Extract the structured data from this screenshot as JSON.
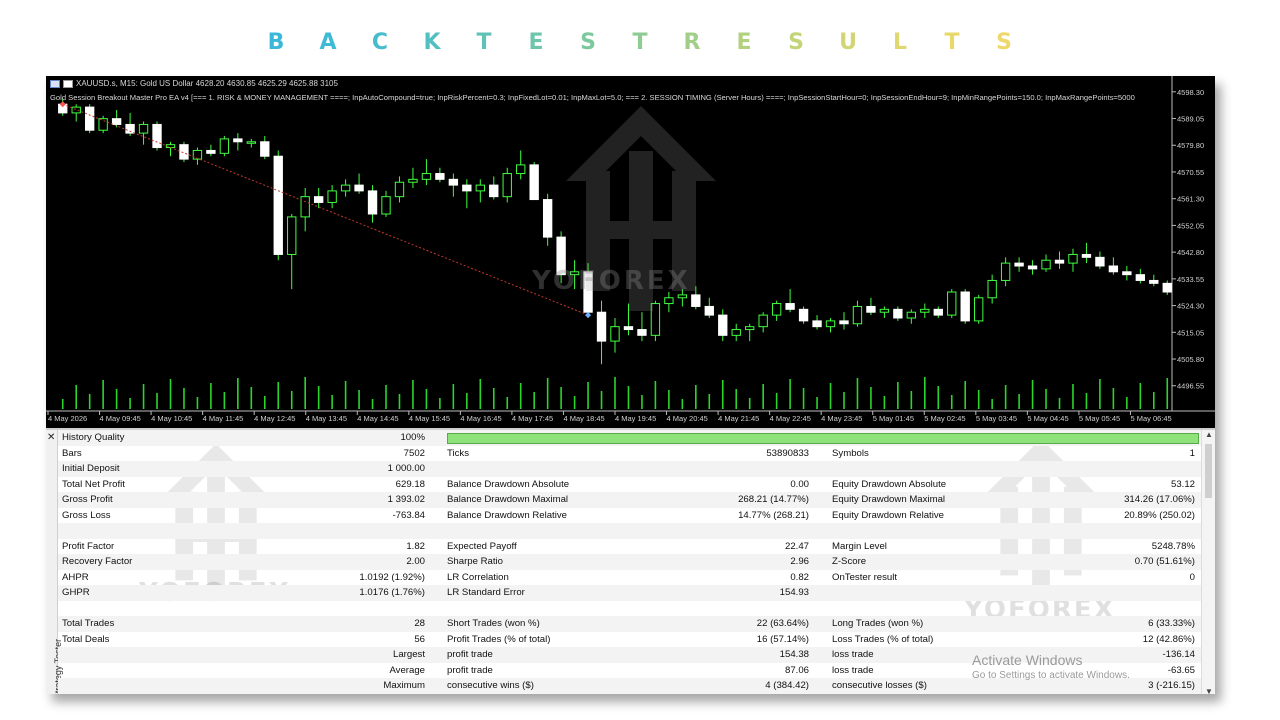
{
  "banner": {
    "letters": [
      "B",
      "A",
      "C",
      "K",
      "T",
      "E",
      "S",
      "T",
      "R",
      "E",
      "S",
      "U",
      "L",
      "T",
      "S"
    ],
    "colors": [
      "#3bb8d9",
      "#3fbad4",
      "#47bccd",
      "#52bfc3",
      "#5fc2b7",
      "#6ec5ab",
      "#7ec89e",
      "#8fcb92",
      "#a1ce88",
      "#b2d17f",
      "#c3d479",
      "#d2d574",
      "#dfd770",
      "#e9d86d",
      "#efd86b"
    ]
  },
  "chart": {
    "symbol_line": "XAUUSD.s, M15:  Gold US Dollar  4628.20 4630.85 4625.29 4625.88  3105",
    "params_line": "Gold Session Breakout Master Pro EA v4 [=== 1. RISK & MONEY MANAGEMENT ====; InpAutoCompound=true; InpRiskPercent=0.3; InpFixedLot=0.01; InpMaxLot=5.0; === 2. SESSION TIMING (Server Hours) ====; InpSessionStartHour=0; InpSessionEndHour=9; InpMinRangePoints=150.0; InpMaxRangePoints=5000",
    "price_labels": [
      "4598.30",
      "4589.05",
      "4579.80",
      "4570.55",
      "4561.30",
      "4552.05",
      "4542.80",
      "4533.55",
      "4524.30",
      "4515.05",
      "4505.80",
      "4496.55"
    ],
    "time_labels": [
      "4 May 2026",
      "4 May 09:45",
      "4 May 10:45",
      "4 May 11:45",
      "4 May 12:45",
      "4 May 13:45",
      "4 May 14:45",
      "4 May 15:45",
      "4 May 16:45",
      "4 May 17:45",
      "4 May 18:45",
      "4 May 19:45",
      "4 May 20:45",
      "4 May 21:45",
      "4 May 22:45",
      "4 May 23:45",
      "5 May 01:45",
      "5 May 02:45",
      "5 May 03:45",
      "5 May 04:45",
      "5 May 05:45",
      "5 May 06:45"
    ],
    "watermark": "YOFOREX",
    "bull_color": "#ffffff",
    "bear_color": "#ffffff",
    "wick_color": "#3fff3f",
    "volume_color": "#2bd62b",
    "candles": [
      [
        4594,
        4596,
        4590,
        4591
      ],
      [
        4591,
        4594,
        4588,
        4593
      ],
      [
        4593,
        4594,
        4584,
        4585
      ],
      [
        4585,
        4590,
        4584,
        4589
      ],
      [
        4589,
        4592,
        4586,
        4587
      ],
      [
        4587,
        4591,
        4583,
        4584
      ],
      [
        4584,
        4588,
        4580,
        4587
      ],
      [
        4587,
        4588,
        4578,
        4579
      ],
      [
        4579,
        4581,
        4576,
        4580
      ],
      [
        4580,
        4581,
        4574,
        4575
      ],
      [
        4575,
        4579,
        4573,
        4578
      ],
      [
        4578,
        4580,
        4576,
        4577
      ],
      [
        4577,
        4583,
        4576,
        4582
      ],
      [
        4582,
        4584,
        4578,
        4581
      ],
      [
        4581,
        4582,
        4579,
        4581
      ],
      [
        4581,
        4583,
        4575,
        4576
      ],
      [
        4576,
        4578,
        4540,
        4542
      ],
      [
        4542,
        4556,
        4530,
        4555
      ],
      [
        4555,
        4565,
        4550,
        4562
      ],
      [
        4562,
        4565,
        4558,
        4560
      ],
      [
        4560,
        4566,
        4558,
        4564
      ],
      [
        4564,
        4568,
        4562,
        4566
      ],
      [
        4566,
        4570,
        4563,
        4564
      ],
      [
        4564,
        4566,
        4553,
        4556
      ],
      [
        4556,
        4564,
        4555,
        4562
      ],
      [
        4562,
        4569,
        4560,
        4567
      ],
      [
        4567,
        4572,
        4565,
        4568
      ],
      [
        4568,
        4575,
        4566,
        4570
      ],
      [
        4570,
        4572,
        4567,
        4568
      ],
      [
        4568,
        4570,
        4562,
        4566
      ],
      [
        4566,
        4568,
        4558,
        4564
      ],
      [
        4564,
        4568,
        4560,
        4566
      ],
      [
        4566,
        4569,
        4561,
        4562
      ],
      [
        4562,
        4572,
        4560,
        4570
      ],
      [
        4570,
        4578,
        4568,
        4573
      ],
      [
        4573,
        4574,
        4561,
        4561
      ],
      [
        4561,
        4563,
        4545,
        4548
      ],
      [
        4548,
        4550,
        4532,
        4535
      ],
      [
        4535,
        4540,
        4530,
        4536
      ],
      [
        4536,
        4539,
        4520,
        4522
      ],
      [
        4522,
        4526,
        4504,
        4512
      ],
      [
        4512,
        4520,
        4508,
        4517
      ],
      [
        4517,
        4525,
        4514,
        4516
      ],
      [
        4516,
        4522,
        4512,
        4514
      ],
      [
        4514,
        4526,
        4512,
        4525
      ],
      [
        4525,
        4529,
        4522,
        4527
      ],
      [
        4527,
        4530,
        4524,
        4528
      ],
      [
        4528,
        4531,
        4523,
        4524
      ],
      [
        4524,
        4527,
        4520,
        4521
      ],
      [
        4521,
        4523,
        4512,
        4514
      ],
      [
        4514,
        4518,
        4512,
        4516
      ],
      [
        4516,
        4518,
        4512,
        4517
      ],
      [
        4517,
        4522,
        4515,
        4521
      ],
      [
        4521,
        4526,
        4519,
        4525
      ],
      [
        4525,
        4530,
        4522,
        4523
      ],
      [
        4523,
        4524,
        4518,
        4519
      ],
      [
        4519,
        4521,
        4516,
        4517
      ],
      [
        4517,
        4520,
        4515,
        4519
      ],
      [
        4519,
        4522,
        4516,
        4518
      ],
      [
        4518,
        4526,
        4517,
        4524
      ],
      [
        4524,
        4527,
        4521,
        4522
      ],
      [
        4522,
        4524,
        4520,
        4523
      ],
      [
        4523,
        4524,
        4519,
        4520
      ],
      [
        4520,
        4523,
        4518,
        4522
      ],
      [
        4522,
        4525,
        4520,
        4523
      ],
      [
        4523,
        4524,
        4520,
        4521
      ],
      [
        4521,
        4530,
        4520,
        4529
      ],
      [
        4529,
        4530,
        4518,
        4519
      ],
      [
        4519,
        4528,
        4518,
        4527
      ],
      [
        4527,
        4535,
        4525,
        4533
      ],
      [
        4533,
        4541,
        4531,
        4539
      ],
      [
        4539,
        4541,
        4536,
        4538
      ],
      [
        4538,
        4540,
        4535,
        4537
      ],
      [
        4537,
        4542,
        4536,
        4540
      ],
      [
        4540,
        4543,
        4537,
        4539
      ],
      [
        4539,
        4544,
        4536,
        4542
      ],
      [
        4542,
        4546,
        4539,
        4541
      ],
      [
        4541,
        4543,
        4537,
        4538
      ],
      [
        4538,
        4541,
        4535,
        4536
      ],
      [
        4536,
        4538,
        4533,
        4535
      ],
      [
        4535,
        4537,
        4532,
        4533
      ],
      [
        4533,
        4535,
        4531,
        4532
      ],
      [
        4532,
        4533,
        4528,
        4529
      ]
    ]
  },
  "tester": {
    "side_label": "Strategy Tester",
    "close_glyph": "✕",
    "quality_bar_color": "#8ee27a",
    "watermark": "YOFOREX",
    "activate_title": "Activate Windows",
    "activate_sub": "Go to Settings to activate Windows.",
    "rows": [
      {
        "c1l": "History Quality",
        "c1v": "100%",
        "c2l": "",
        "c2v": "",
        "c3l": "",
        "c3v": "",
        "bar": true
      },
      {
        "c1l": "Bars",
        "c1v": "7502",
        "c2l": "Ticks",
        "c2v": "53890833",
        "c3l": "Symbols",
        "c3v": "1"
      },
      {
        "c1l": "Initial Deposit",
        "c1v": "1 000.00",
        "c2l": "",
        "c2v": "",
        "c3l": "",
        "c3v": ""
      },
      {
        "c1l": "Total Net Profit",
        "c1v": "629.18",
        "c2l": "Balance Drawdown Absolute",
        "c2v": "0.00",
        "c3l": "Equity Drawdown Absolute",
        "c3v": "53.12"
      },
      {
        "c1l": "Gross Profit",
        "c1v": "1 393.02",
        "c2l": "Balance Drawdown Maximal",
        "c2v": "268.21 (14.77%)",
        "c3l": "Equity Drawdown Maximal",
        "c3v": "314.26 (17.06%)"
      },
      {
        "c1l": "Gross Loss",
        "c1v": "-763.84",
        "c2l": "Balance Drawdown Relative",
        "c2v": "14.77% (268.21)",
        "c3l": "Equity Drawdown Relative",
        "c3v": "20.89% (250.02)"
      },
      {
        "c1l": "",
        "c1v": "",
        "c2l": "",
        "c2v": "",
        "c3l": "",
        "c3v": ""
      },
      {
        "c1l": "Profit Factor",
        "c1v": "1.82",
        "c2l": "Expected Payoff",
        "c2v": "22.47",
        "c3l": "Margin Level",
        "c3v": "5248.78%"
      },
      {
        "c1l": "Recovery Factor",
        "c1v": "2.00",
        "c2l": "Sharpe Ratio",
        "c2v": "2.96",
        "c3l": "Z-Score",
        "c3v": "0.70 (51.61%)"
      },
      {
        "c1l": "AHPR",
        "c1v": "1.0192 (1.92%)",
        "c2l": "LR Correlation",
        "c2v": "0.82",
        "c3l": "OnTester result",
        "c3v": "0"
      },
      {
        "c1l": "GHPR",
        "c1v": "1.0176 (1.76%)",
        "c2l": "LR Standard Error",
        "c2v": "154.93",
        "c3l": "",
        "c3v": ""
      },
      {
        "c1l": "",
        "c1v": "",
        "c2l": "",
        "c2v": "",
        "c3l": "",
        "c3v": ""
      },
      {
        "c1l": "Total Trades",
        "c1v": "28",
        "c2l": "Short Trades (won %)",
        "c2v": "22 (63.64%)",
        "c3l": "Long Trades (won %)",
        "c3v": "6 (33.33%)"
      },
      {
        "c1l": "Total Deals",
        "c1v": "56",
        "c2l": "Profit Trades (% of total)",
        "c2v": "16 (57.14%)",
        "c3l": "Loss Trades (% of total)",
        "c3v": "12 (42.86%)"
      },
      {
        "c1l": "",
        "c1v": "Largest",
        "c2l": "profit trade",
        "c2v": "154.38",
        "c3l": "loss trade",
        "c3v": "-136.14"
      },
      {
        "c1l": "",
        "c1v": "Average",
        "c2l": "profit trade",
        "c2v": "87.06",
        "c3l": "loss trade",
        "c3v": "-63.65"
      },
      {
        "c1l": "",
        "c1v": "Maximum",
        "c2l": "consecutive wins ($)",
        "c2v": "4 (384.42)",
        "c3l": "consecutive losses ($)",
        "c3v": "3 (-216.15)"
      }
    ]
  }
}
